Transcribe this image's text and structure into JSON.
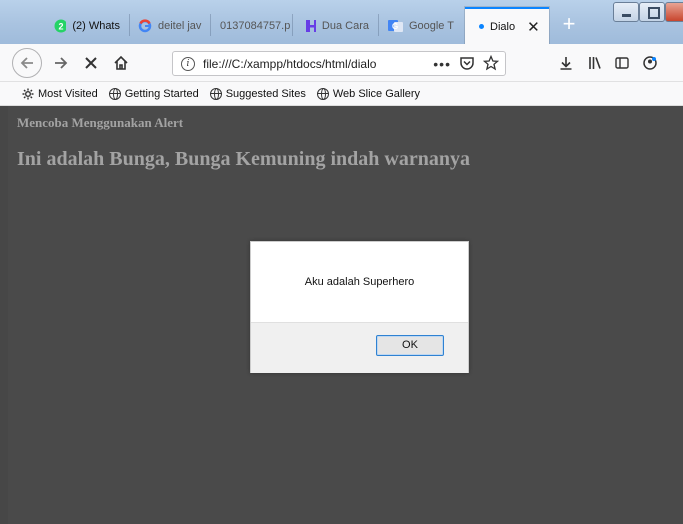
{
  "browser": {
    "tabs": [
      {
        "label": "(2) Whats",
        "icon": "whatsapp-icon"
      },
      {
        "label": "deitel jav",
        "icon": "google-icon"
      },
      {
        "label": "0137084757.p",
        "icon": ""
      },
      {
        "label": "Dua Cara",
        "icon": "hostinger-icon"
      },
      {
        "label": "Google T",
        "icon": "google-translate-icon"
      },
      {
        "label": "Dialo",
        "icon": "dot-icon",
        "active": true
      }
    ],
    "new_tab_label": "+",
    "close_tab_label": "✕",
    "url": "file:///C:/xampp/htdocs/html/dialo",
    "more_label": "•••",
    "bookmarks": [
      {
        "label": "Most Visited",
        "icon": "gear-icon"
      },
      {
        "label": "Getting Started",
        "icon": "globe-icon"
      },
      {
        "label": "Suggested Sites",
        "icon": "globe-icon"
      },
      {
        "label": "Web Slice Gallery",
        "icon": "globe-icon"
      }
    ]
  },
  "page": {
    "title": "Mencoba Menggunakan Alert",
    "heading": "Ini adalah Bunga, Bunga Kemuning indah warnanya"
  },
  "dialog": {
    "message": "Aku adalah Superhero",
    "ok_label": "OK"
  },
  "colors": {
    "accent": "#0a84ff",
    "page_bg": "#4a4a4a",
    "page_text": "#a3a3a3"
  }
}
